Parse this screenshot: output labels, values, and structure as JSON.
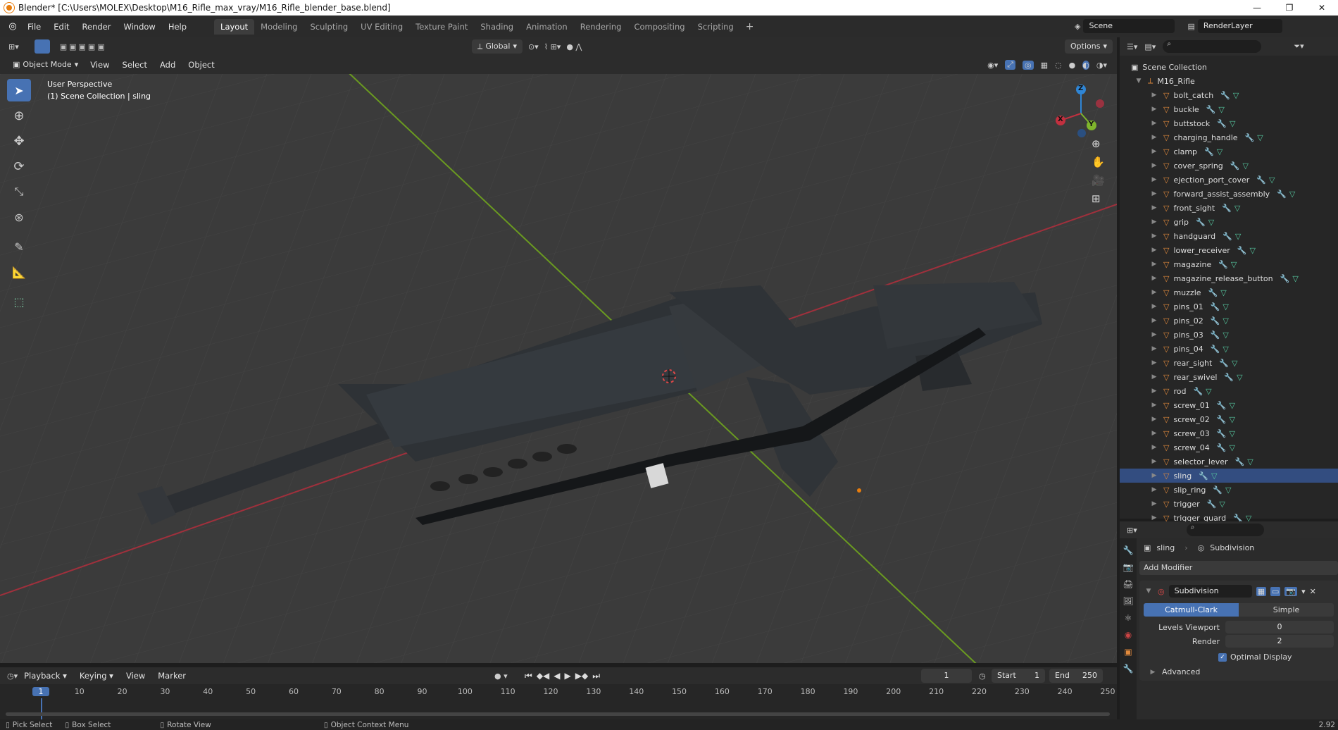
{
  "titlebar": {
    "title": "Blender* [C:\\Users\\MOLEX\\Desktop\\M16_Rifle_max_vray/M16_Rifle_blender_base.blend]",
    "minimize": "—",
    "maximize": "❐",
    "close": "✕"
  },
  "menus": [
    "File",
    "Edit",
    "Render",
    "Window",
    "Help"
  ],
  "workspaces": [
    "Layout",
    "Modeling",
    "Sculpting",
    "UV Editing",
    "Texture Paint",
    "Shading",
    "Animation",
    "Rendering",
    "Compositing",
    "Scripting"
  ],
  "workspace_active": "Layout",
  "scene": {
    "label": "Scene",
    "render_layer": "RenderLayer"
  },
  "viewport": {
    "transform_orientation": "Global",
    "options": "Options",
    "mode": "Object Mode",
    "header_menus": [
      "View",
      "Select",
      "Add",
      "Object"
    ],
    "overlay_text_1": "User Perspective",
    "overlay_text_2": "(1) Scene Collection | sling",
    "gizmo": {
      "x": "X",
      "y": "Y",
      "z": "Z"
    }
  },
  "outliner": {
    "root": "Scene Collection",
    "collection": "M16_Rifle",
    "items": [
      "bolt_catch",
      "buckle",
      "buttstock",
      "charging_handle",
      "clamp",
      "cover_spring",
      "ejection_port_cover",
      "forward_assist_assembly",
      "front_sight",
      "grip",
      "handguard",
      "lower_receiver",
      "magazine",
      "magazine_release_button",
      "muzzle",
      "pins_01",
      "pins_02",
      "pins_03",
      "pins_04",
      "rear_sight",
      "rear_swivel",
      "rod",
      "screw_01",
      "screw_02",
      "screw_03",
      "screw_04",
      "selector_lever",
      "sling",
      "slip_ring",
      "trigger",
      "trigger_guard"
    ],
    "selected": "sling"
  },
  "properties": {
    "object": "sling",
    "modifier_context": "Subdivision",
    "add_modifier": "Add Modifier",
    "modifier_name": "Subdivision",
    "tabs": [
      "Catmull-Clark",
      "Simple"
    ],
    "active_tab": "Catmull-Clark",
    "levels_viewport_label": "Levels Viewport",
    "levels_viewport": "0",
    "render_label": "Render",
    "render": "2",
    "optimal_display": "Optimal Display",
    "advanced": "Advanced"
  },
  "timeline": {
    "menus": [
      "Playback",
      "Keying",
      "View",
      "Marker"
    ],
    "current_frame": "1",
    "start_label": "Start",
    "start": "1",
    "end_label": "End",
    "end": "250",
    "ticks": [
      "1",
      "10",
      "20",
      "30",
      "40",
      "50",
      "60",
      "70",
      "80",
      "90",
      "100",
      "110",
      "120",
      "130",
      "140",
      "150",
      "160",
      "170",
      "180",
      "190",
      "200",
      "210",
      "220",
      "230",
      "240",
      "250"
    ]
  },
  "statusbar": {
    "select": "Pick Select",
    "box": "Box Select",
    "rotate": "Rotate View",
    "context": "Object Context Menu",
    "version": "2.92"
  },
  "colors": {
    "accent": "#4772b3",
    "x_axis": "#c2303f",
    "y_axis": "#7fb52c",
    "z_axis": "#2f86d6",
    "mesh_icon": "#e28a3c",
    "modifier_icon": "#6d9ee8",
    "vertex_icon": "#56c8a0"
  }
}
